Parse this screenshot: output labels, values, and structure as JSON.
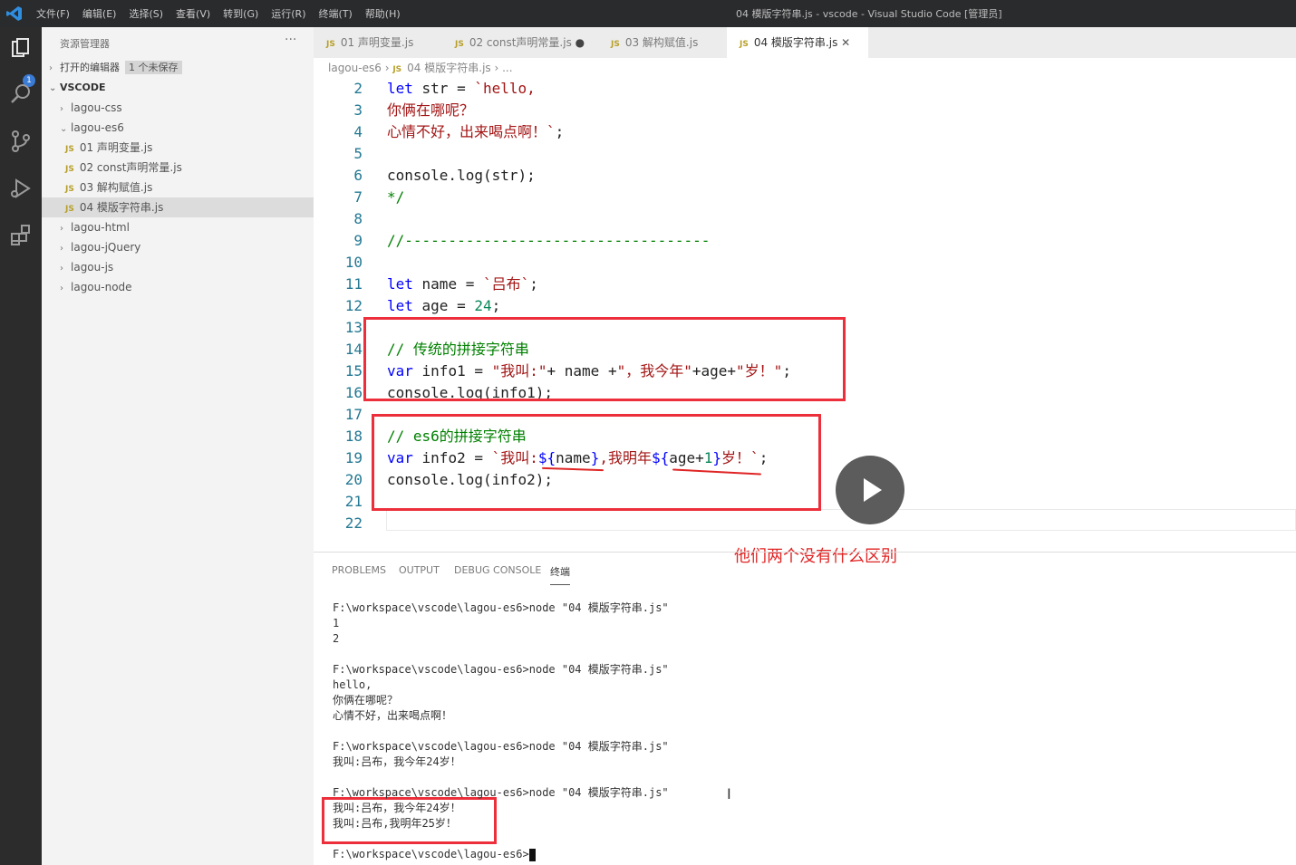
{
  "titlebar": {
    "menu": [
      "文件(F)",
      "编辑(E)",
      "选择(S)",
      "查看(V)",
      "转到(G)",
      "运行(R)",
      "终端(T)",
      "帮助(H)"
    ],
    "title": "04 模版字符串.js - vscode - Visual Studio Code [管理员]"
  },
  "activity": {
    "badge": "1"
  },
  "sidebar": {
    "header": "资源管理器",
    "more": "···",
    "open_editors": "打开的编辑器",
    "unsaved": "1 个未保存",
    "root": "VSCODE",
    "items": [
      {
        "label": "lagou-css",
        "type": "folder",
        "expanded": false
      },
      {
        "label": "lagou-es6",
        "type": "folder",
        "expanded": true
      },
      {
        "label": "01 声明变量.js",
        "type": "file",
        "icon": "JS"
      },
      {
        "label": "02 const声明常量.js",
        "type": "file",
        "icon": "JS"
      },
      {
        "label": "03 解构赋值.js",
        "type": "file",
        "icon": "JS"
      },
      {
        "label": "04 模版字符串.js",
        "type": "file",
        "icon": "JS",
        "selected": true
      },
      {
        "label": "lagou-html",
        "type": "folder",
        "expanded": false
      },
      {
        "label": "lagou-jQuery",
        "type": "folder",
        "expanded": false
      },
      {
        "label": "lagou-js",
        "type": "folder",
        "expanded": false
      },
      {
        "label": "lagou-node",
        "type": "folder",
        "expanded": false
      }
    ]
  },
  "tabs": [
    {
      "icon": "JS",
      "label": "01 声明变量.js",
      "suffix": ""
    },
    {
      "icon": "JS",
      "label": "02 const声明常量.js",
      "suffix": "●"
    },
    {
      "icon": "JS",
      "label": "03 解构赋值.js",
      "suffix": ""
    },
    {
      "icon": "JS",
      "label": "04 模版字符串.js",
      "suffix": "✕",
      "active": true
    }
  ],
  "breadcrumb": {
    "folder": "lagou-es6",
    "sep": "›",
    "icon": "JS",
    "file": "04 模版字符串.js",
    "tail": "› ..."
  },
  "code": {
    "lines": [
      {
        "n": "2",
        "t": [
          [
            "kw",
            "let"
          ],
          [
            "",
            " str = "
          ],
          [
            "str",
            "`hello,"
          ]
        ]
      },
      {
        "n": "3",
        "t": [
          [
            "str",
            "你俩在哪呢？"
          ]
        ]
      },
      {
        "n": "4",
        "t": [
          [
            "str",
            "心情不好，出来喝点啊！`"
          ],
          [
            "",
            ";"
          ]
        ]
      },
      {
        "n": "5",
        "t": []
      },
      {
        "n": "6",
        "t": [
          [
            "",
            "console.log(str);"
          ]
        ]
      },
      {
        "n": "7",
        "t": [
          [
            "cm",
            "*/"
          ]
        ]
      },
      {
        "n": "8",
        "t": []
      },
      {
        "n": "9",
        "t": [
          [
            "cm",
            "//-----------------------------------"
          ]
        ]
      },
      {
        "n": "10",
        "t": []
      },
      {
        "n": "11",
        "t": [
          [
            "kw",
            "let"
          ],
          [
            "",
            " name = "
          ],
          [
            "str",
            "`吕布`"
          ],
          [
            "",
            ";"
          ]
        ]
      },
      {
        "n": "12",
        "t": [
          [
            "kw",
            "let"
          ],
          [
            "",
            " age = "
          ],
          [
            "num",
            "24"
          ],
          [
            "",
            ";"
          ]
        ]
      },
      {
        "n": "13",
        "t": []
      },
      {
        "n": "14",
        "t": [
          [
            "cm",
            "// 传统的拼接字符串"
          ]
        ]
      },
      {
        "n": "15",
        "t": [
          [
            "kw",
            "var"
          ],
          [
            "",
            " info1 = "
          ],
          [
            "str",
            "\"我叫:\""
          ],
          [
            "",
            "+ name +"
          ],
          [
            "str",
            "\"，我今年\""
          ],
          [
            "",
            "+age+"
          ],
          [
            "str",
            "\"岁！\""
          ],
          [
            "",
            ";"
          ]
        ]
      },
      {
        "n": "16",
        "t": [
          [
            "",
            "console.log(info1);"
          ]
        ]
      },
      {
        "n": "17",
        "t": []
      },
      {
        "n": "18",
        "t": [
          [
            "cm",
            "// es6的拼接字符串"
          ]
        ]
      },
      {
        "n": "19",
        "t": [
          [
            "kw",
            "var"
          ],
          [
            "",
            " info2 = "
          ],
          [
            "str",
            "`我叫:"
          ],
          [
            "tpl",
            "${"
          ],
          [
            "",
            "name"
          ],
          [
            "tpl",
            "}"
          ],
          [
            "str",
            ",我明年"
          ],
          [
            "tpl",
            "${"
          ],
          [
            "",
            "age+"
          ],
          [
            "num",
            "1"
          ],
          [
            "tpl",
            "}"
          ],
          [
            "str",
            "岁！`"
          ],
          [
            "",
            ";"
          ]
        ]
      },
      {
        "n": "20",
        "t": [
          [
            "",
            "console.log(info2);"
          ]
        ]
      },
      {
        "n": "21",
        "t": []
      },
      {
        "n": "22",
        "t": []
      }
    ]
  },
  "annotation": "他们两个没有什么区别",
  "panel": {
    "tabs": [
      {
        "label": "PROBLEMS"
      },
      {
        "label": "OUTPUT"
      },
      {
        "label": "DEBUG CONSOLE"
      },
      {
        "label": "终端",
        "active": true
      }
    ]
  },
  "terminal": {
    "lines": [
      "F:\\workspace\\vscode\\lagou-es6>node \"04 模版字符串.js\"",
      "1",
      "2",
      "",
      "F:\\workspace\\vscode\\lagou-es6>node \"04 模版字符串.js\"",
      "hello,",
      "你俩在哪呢？",
      "心情不好，出来喝点啊！",
      "",
      "F:\\workspace\\vscode\\lagou-es6>node \"04 模版字符串.js\"",
      "我叫:吕布，我今年24岁！",
      "",
      "F:\\workspace\\vscode\\lagou-es6>node \"04 模版字符串.js\"",
      "我叫:吕布，我今年24岁！",
      "我叫:吕布,我明年25岁！",
      "",
      "F:\\workspace\\vscode\\lagou-es6>"
    ]
  }
}
